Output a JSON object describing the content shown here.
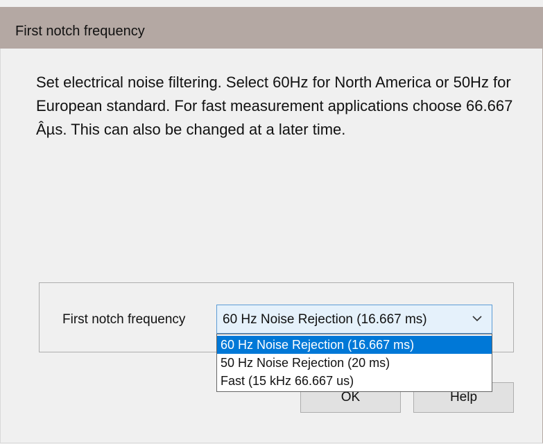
{
  "window": {
    "title": "First notch frequency"
  },
  "description": "Set electrical noise filtering. Select 60Hz for North America or 50Hz for European standard. For fast measurement applications choose 66.667 Âµs. This can also be changed at a later time.",
  "field": {
    "label": "First notch frequency",
    "selected_value": "60 Hz Noise Rejection (16.667 ms)",
    "options": [
      "60 Hz Noise Rejection (16.667 ms)",
      "50 Hz Noise Rejection (20 ms)",
      "Fast (15 kHz 66.667 us)"
    ],
    "highlighted_option_index": 0,
    "arrow_icon": "chevron-down-icon"
  },
  "buttons": {
    "ok_label": "OK",
    "help_label": "Help"
  },
  "colors": {
    "titlebar": "#b4a8a3",
    "selection": "#0078d7",
    "combo_focus_border": "#5b9bd5"
  }
}
